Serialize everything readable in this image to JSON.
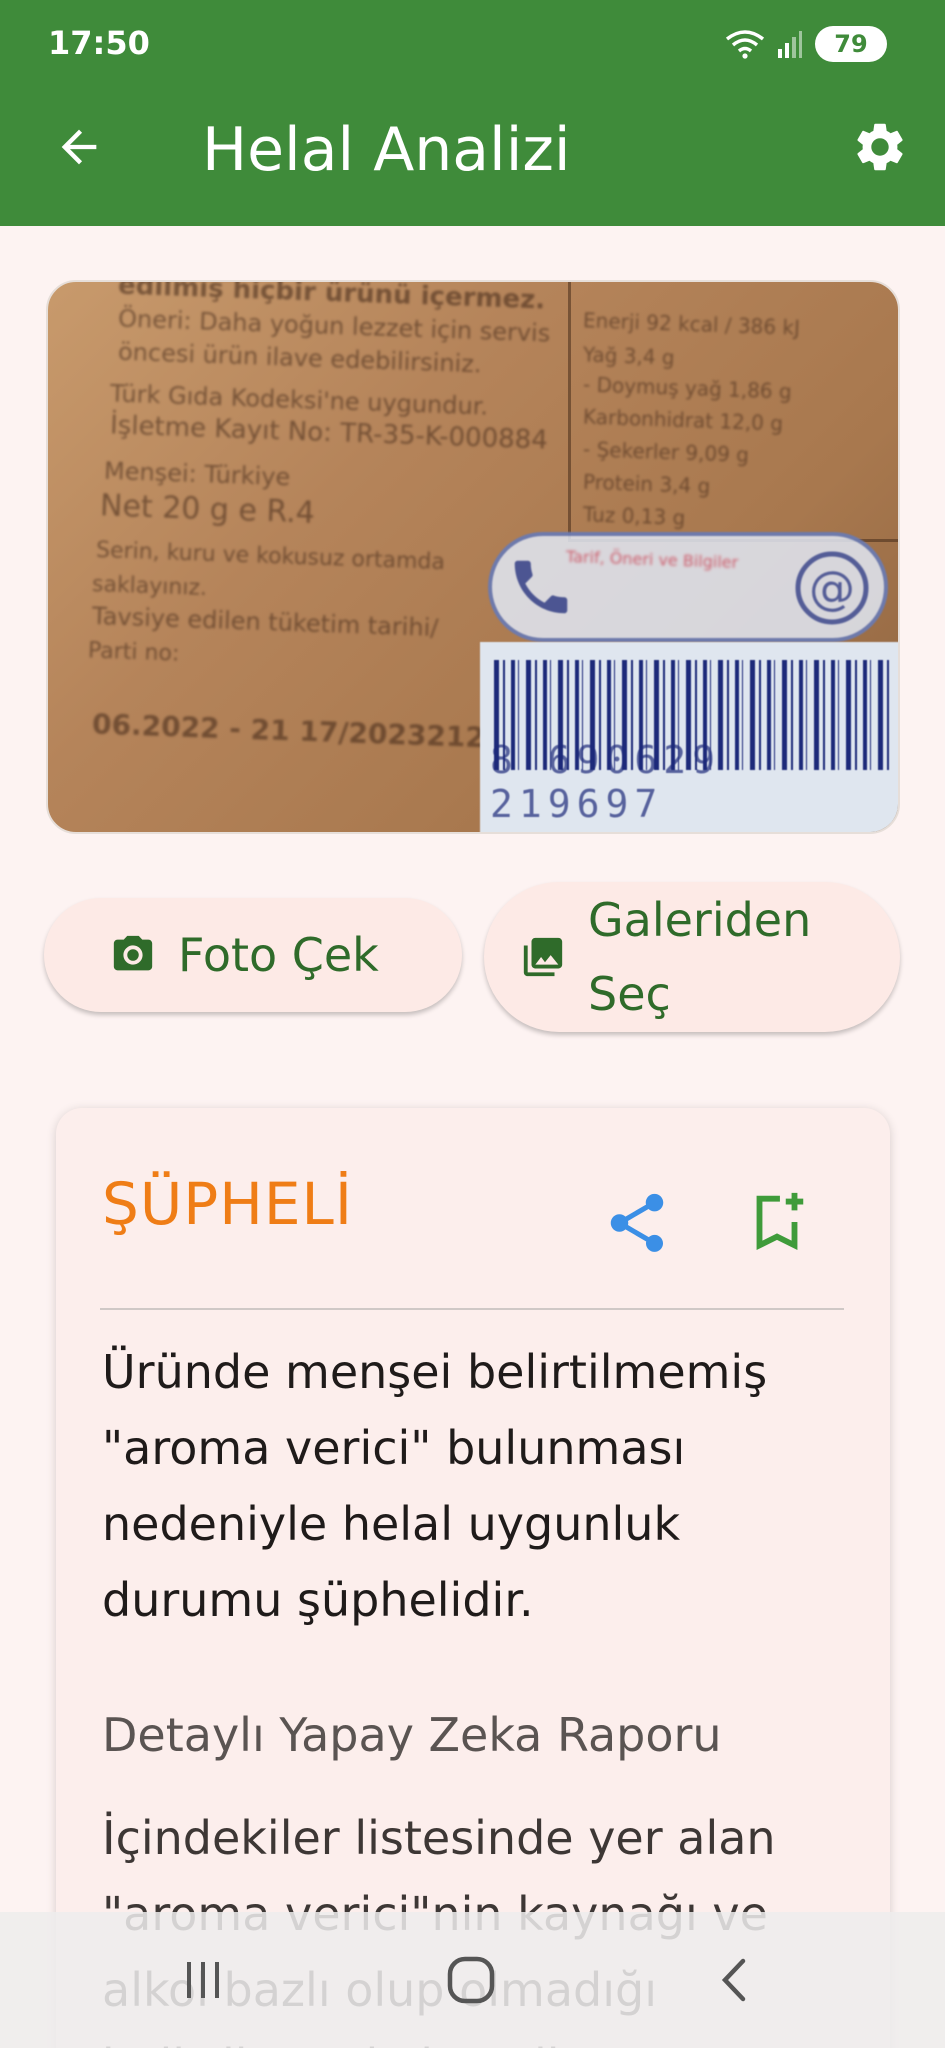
{
  "status_bar": {
    "time": "17:50",
    "battery": "79"
  },
  "app_bar": {
    "title": "Helal Analizi"
  },
  "photo": {
    "lines": [
      "edilmiş hiçbir ürünü içermez.",
      "Öneri: Daha yoğun lezzet için servis",
      "öncesi ürün ilave edebilirsiniz.",
      "Türk Gıda Kodeksi'ne uygundur.",
      "İşletme Kayıt No: TR-35-K-000884",
      "Menşei: Türkiye",
      "Net 20 g  e  R.4",
      "Serin, kuru ve kokusuz ortamda",
      "saklayınız.",
      "Tavsiye edilen tüketim tarihi/",
      "Parti no:",
      "06.2022 - 21 17/2023212"
    ],
    "nutrition": [
      "Enerji   92 kcal / 386 kJ",
      "Yağ   3,4 g",
      "- Doymuş yağ   1,86 g",
      "Karbonhidrat   12,0 g",
      "- Şekerler   9,09 g",
      "Protein   3,4 g",
      "Tuz   0,13 g"
    ],
    "contact": "Tarif, Öneri ve Bilgiler",
    "barcode_number": "8 690629 219697"
  },
  "actions": {
    "camera_label": "Foto Çek",
    "gallery_label": "Galeriden Seç"
  },
  "result": {
    "verdict": "ŞÜPHELİ",
    "verdict_color": "#ef7d16",
    "summary": "Üründe menşei belirtilmemiş \"aroma verici\" bulunması nedeniyle helal uygunluk durumu şüphelidir.",
    "detail_title": "Detaylı Yapay Zeka Raporu",
    "detail_text": "İçindekiler listesinde yer alan \"aroma verici\"nin kaynağı ve alkol bazlı olup olmadığı belirtilmemiştir. Kullanıcının"
  },
  "colors": {
    "primary": "#3f8b3a",
    "accent_blue": "#3b8fe6",
    "button_bg": "#fdeae6"
  }
}
